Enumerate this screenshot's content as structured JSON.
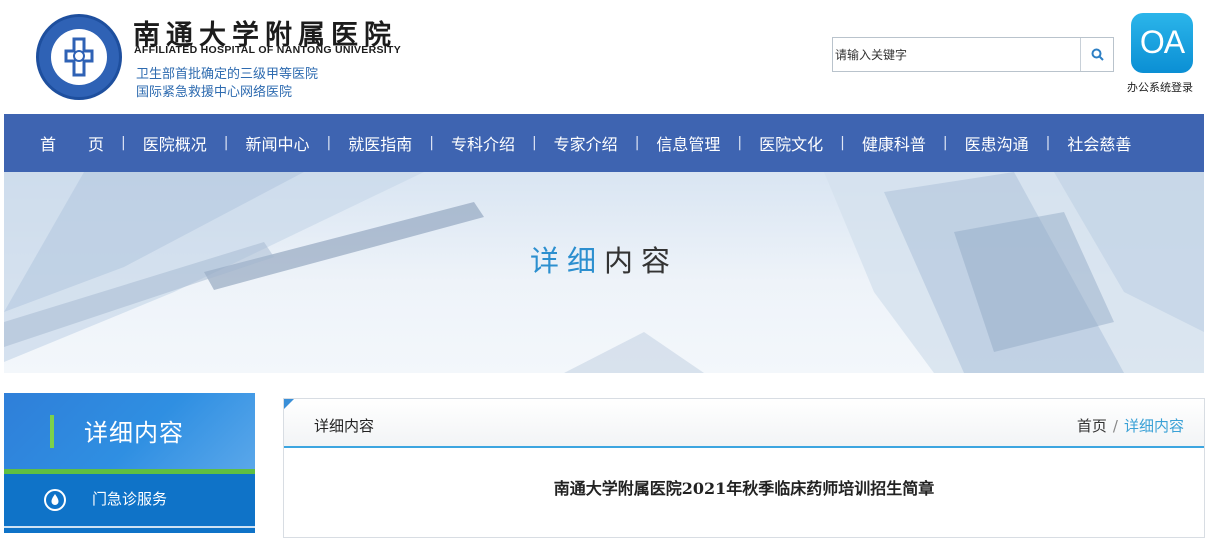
{
  "header": {
    "title": "南通大学附属医院",
    "subtitle_en": "AFFILIATED HOSPITAL OF NANTONG UNIVERSITY",
    "tagline1": "卫生部首批确定的三级甲等医院",
    "tagline2": "国际紧急救援中心网络医院",
    "search_placeholder": "请输入关键字",
    "oa_icon_text": "OA",
    "oa_label": "办公系统登录"
  },
  "nav": {
    "items": [
      "首　　页",
      "医院概况",
      "新闻中心",
      "就医指南",
      "专科介绍",
      "专家介绍",
      "信息管理",
      "医院文化",
      "健康科普",
      "医患沟通",
      "社会慈善"
    ],
    "separator": "|"
  },
  "banner": {
    "title_part1": "详细",
    "title_part2": "内容"
  },
  "sidebar": {
    "heading": "详细内容",
    "items": [
      {
        "label": "门急诊服务",
        "icon": "drop-icon"
      }
    ]
  },
  "main": {
    "section_title": "详细内容",
    "breadcrumb": {
      "home": "首页",
      "separator": "/",
      "current": "详细内容"
    },
    "article_title": "南通大学附属医院2021年秋季临床药师培训招生简章"
  },
  "colors": {
    "nav_bg": "#3e64b1",
    "accent_blue": "#2c8fcf",
    "sidebar_blue": "#0f73c8",
    "sidebar_green": "#5fbf42"
  }
}
